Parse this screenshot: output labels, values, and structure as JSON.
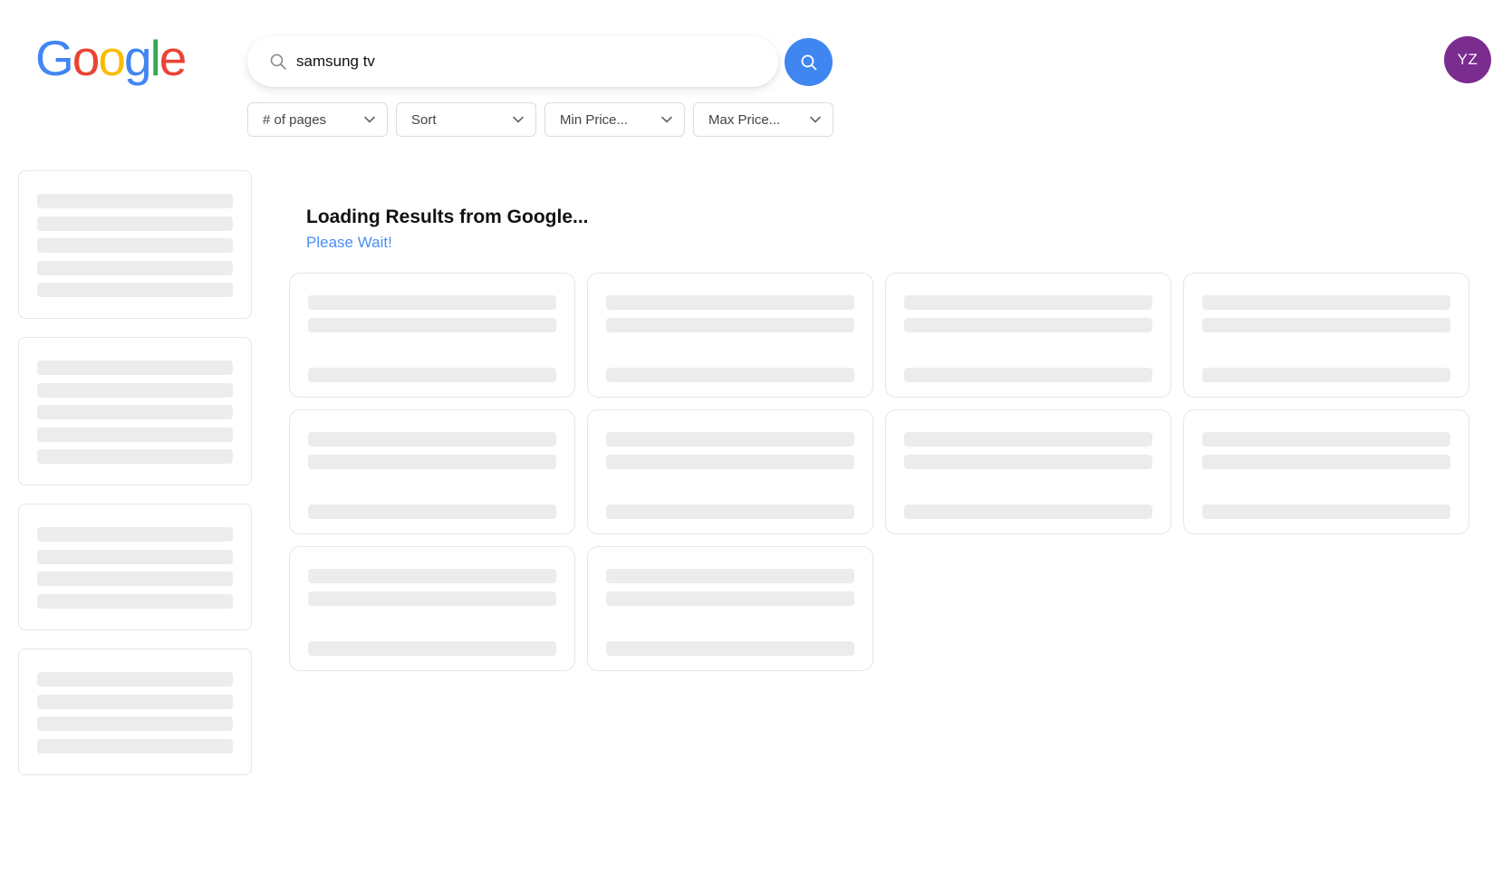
{
  "logo": {
    "letters": [
      {
        "char": "G",
        "color": "#4285F4"
      },
      {
        "char": "o",
        "color": "#EA4335"
      },
      {
        "char": "o",
        "color": "#FBBC05"
      },
      {
        "char": "g",
        "color": "#4285F4"
      },
      {
        "char": "l",
        "color": "#34A853"
      },
      {
        "char": "e",
        "color": "#EA4335"
      }
    ]
  },
  "search": {
    "value": "samsung tv",
    "icon": "search-icon",
    "button_icon": "search-icon",
    "button_color": "#3f86f0"
  },
  "user": {
    "initials": "YZ",
    "avatar_color": "#7b2c8f"
  },
  "filters": [
    {
      "label": "# of pages"
    },
    {
      "label": "Sort"
    },
    {
      "label": "Min Price..."
    },
    {
      "label": "Max Price..."
    }
  ],
  "status": {
    "title": "Loading Results from Google...",
    "subtitle": "Please Wait!",
    "subtitle_color": "#4b8ef5"
  }
}
